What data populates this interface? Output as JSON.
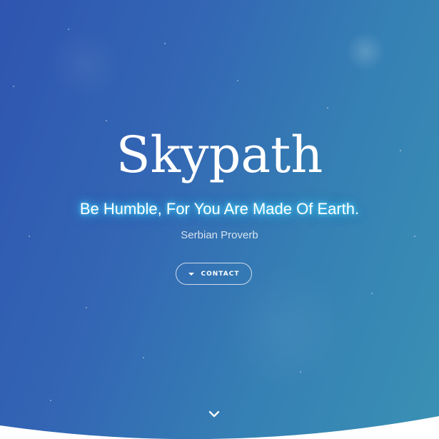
{
  "hero": {
    "title": "Skypath",
    "tagline": "Be Humble, For You Are Made Of Earth.",
    "author": "Serbian Proverb",
    "contact_button": {
      "label": "CONTACT",
      "icon": "caret-down-icon"
    },
    "scroll_icon": "chevron-down-icon"
  },
  "colors": {
    "gradient_start": "#2f55b0",
    "gradient_end": "#3a91b4",
    "tagline_glow": "#49d9ff",
    "text": "#ffffff"
  }
}
